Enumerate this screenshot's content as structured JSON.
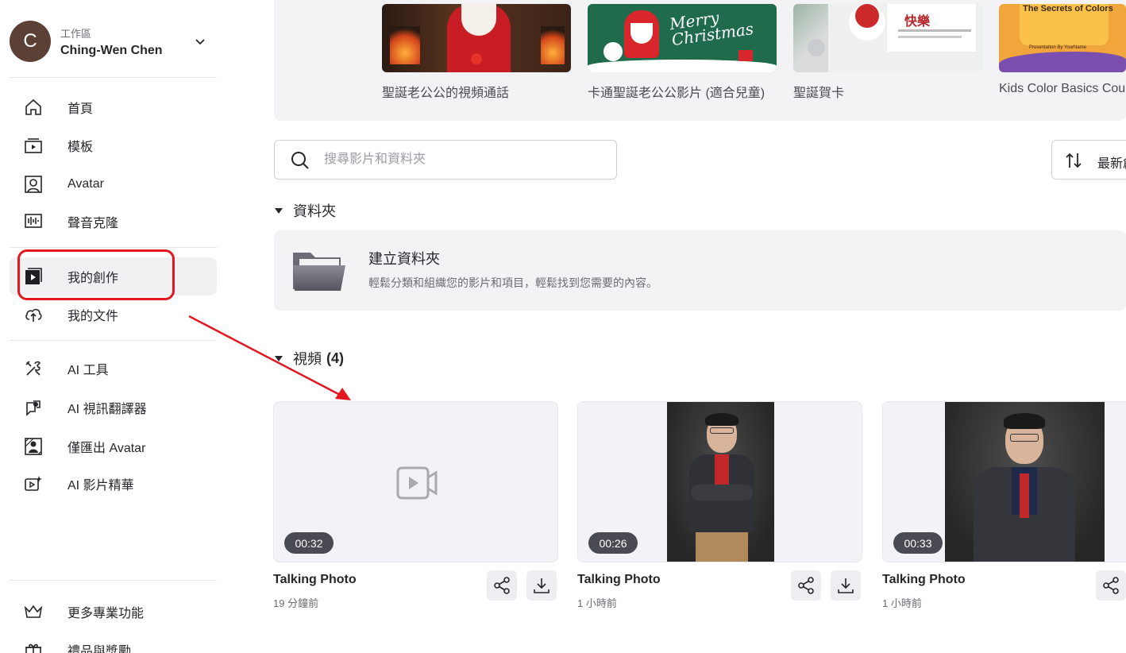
{
  "workspace": {
    "label": "工作區",
    "name": "Ching-Wen Chen",
    "avatar_letter": "C",
    "avatar_color": "#5b4036"
  },
  "nav": {
    "items": [
      {
        "label": "首頁",
        "icon": "home-icon"
      },
      {
        "label": "模板",
        "icon": "template-icon"
      },
      {
        "label": "Avatar",
        "icon": "avatar-icon"
      },
      {
        "label": "聲音克隆",
        "icon": "voice-clone-icon"
      },
      {
        "label": "我的創作",
        "icon": "my-creations-icon",
        "active": true
      },
      {
        "label": "我的文件",
        "icon": "upload-icon"
      }
    ],
    "tools": [
      {
        "label": "AI 工具",
        "icon": "tools-icon"
      },
      {
        "label": "AI 視訊翻譯器",
        "icon": "video-translate-icon"
      },
      {
        "label": "僅匯出 Avatar",
        "icon": "export-avatar-icon"
      },
      {
        "label": "AI 影片精華",
        "icon": "highlights-icon"
      }
    ],
    "bottom": [
      {
        "label": "更多專業功能",
        "icon": "crown-icon"
      },
      {
        "label": "禮品與獎勵",
        "icon": "gift-icon"
      }
    ]
  },
  "templates": [
    {
      "title": "聖誕老公公的視頻通話"
    },
    {
      "title": "卡通聖誕老公公影片 (適合兒童)",
      "thumb_text": "Merry Christmas"
    },
    {
      "title": "聖誕賀卡",
      "thumb_text": "快樂"
    },
    {
      "title": "Kids Color Basics Cou",
      "thumb_text": "The Secrets of Colors",
      "thumb_sub": "Presentation By YourName"
    }
  ],
  "search": {
    "placeholder": "搜尋影片和資料夾"
  },
  "sort": {
    "label": "最新創"
  },
  "folders": {
    "heading": "資料夾",
    "create_title": "建立資料夾",
    "create_desc": "輕鬆分類和組織您的影片和項目，輕鬆找到您需要的內容。"
  },
  "videos": {
    "heading": "視頻",
    "count": "(4)",
    "items": [
      {
        "title": "Talking Photo",
        "duration": "00:32",
        "time": "19 分鐘前"
      },
      {
        "title": "Talking Photo",
        "duration": "00:26",
        "time": "1 小時前"
      },
      {
        "title": "Talking Photo",
        "duration": "00:33",
        "time": "1 小時前"
      }
    ]
  },
  "colors": {
    "accent_red": "#e3171f",
    "panel_bg": "#f3f3f6"
  }
}
